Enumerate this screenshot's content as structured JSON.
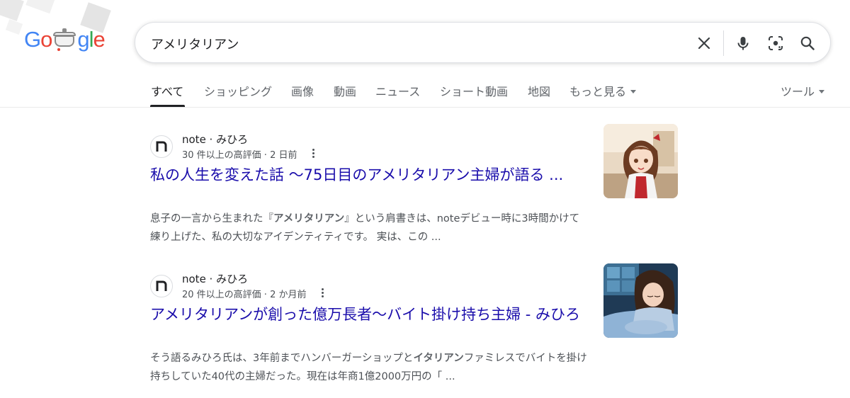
{
  "header": {
    "logo_text": "Google",
    "search_query": "アメリタリアン",
    "icons": [
      "close-icon",
      "mic-icon",
      "lens-icon",
      "search-icon"
    ]
  },
  "tabs": [
    {
      "label": "すべて",
      "active": true
    },
    {
      "label": "ショッピング"
    },
    {
      "label": "画像"
    },
    {
      "label": "動画"
    },
    {
      "label": "ニュース"
    },
    {
      "label": "ショート動画"
    },
    {
      "label": "地図"
    },
    {
      "label": "もっと見る"
    }
  ],
  "tools_label": "ツール",
  "results": [
    {
      "source": "note · みひろ",
      "meta": "30 件以上の高評価 · 2 日前",
      "title": "私の人生を変えた話 〜75日目のアメリタリアン主婦が語る ...",
      "snippet_1": "息子の一言から生まれた『",
      "snippet_bold": "アメリタリアン",
      "snippet_2": "』という肩書きは、noteデビュー時に3時間かけて練り上げた、私の大切なアイデンティティです。 実は、この ..."
    },
    {
      "source": "note · みひろ",
      "meta": "20 件以上の高評価 · 2 か月前",
      "title": "アメリタリアンが創った億万長者〜バイト掛け持ち主婦 - みひろ",
      "snippet_1": "そう語るみひろ氏は、3年前までハンバーガーショップと",
      "snippet_bold": "イタリアン",
      "snippet_2": "ファミレスでバイトを掛け持ちしていた40代の主婦だった。現在は年商1億2000万円の「 ..."
    }
  ],
  "colors": {
    "link": "#1a0dab",
    "text": "#202124",
    "muted": "#4d5156"
  }
}
